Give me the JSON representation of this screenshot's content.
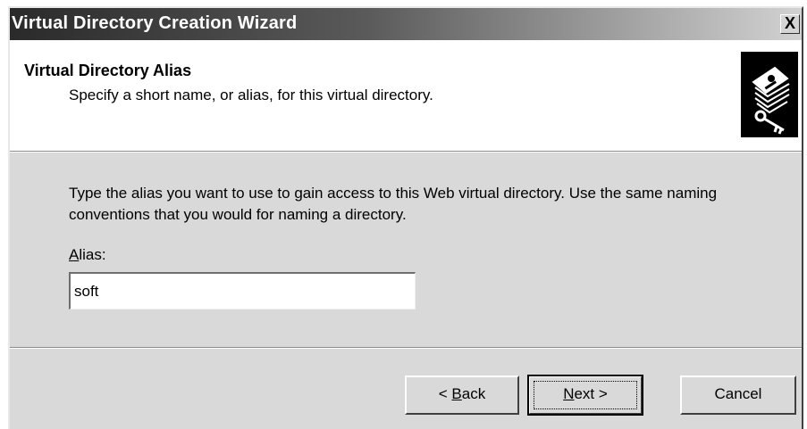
{
  "window": {
    "title": "Virtual Directory Creation Wizard",
    "close_label": "X"
  },
  "header": {
    "title": "Virtual Directory Alias",
    "subtitle": "Specify a short name, or alias, for this virtual directory.",
    "icon": "wizard-icon"
  },
  "body": {
    "instructions": "Type the alias you want to use to gain access to this Web virtual directory. Use the same naming conventions that you would for naming a directory.",
    "alias_label_mnemonic": "A",
    "alias_label_rest": "lias:",
    "alias_value": "soft"
  },
  "buttons": {
    "back_prefix": "< ",
    "back_mnemonic": "B",
    "back_rest": "ack",
    "next_mnemonic": "N",
    "next_rest": "ext >",
    "cancel": "Cancel"
  }
}
